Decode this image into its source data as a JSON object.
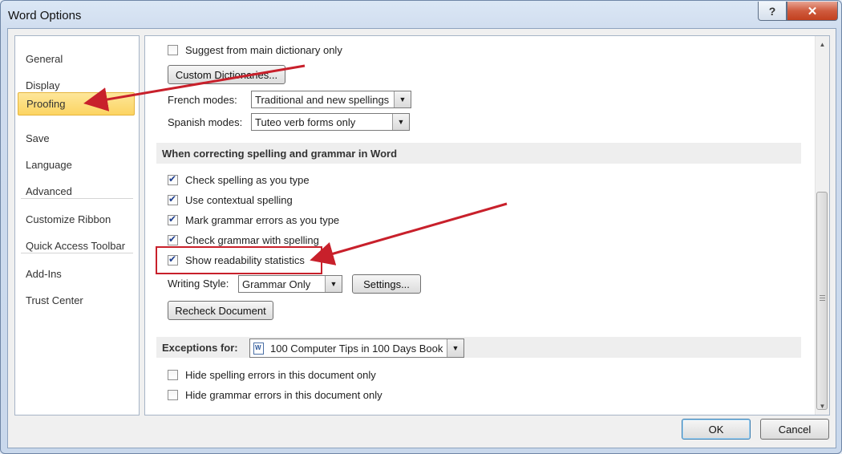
{
  "window": {
    "title": "Word Options",
    "help_label": "?",
    "close_label": "✕"
  },
  "nav": {
    "items": [
      {
        "label": "General"
      },
      {
        "label": "Display"
      },
      {
        "label": "Proofing"
      },
      {
        "label": "Save"
      },
      {
        "label": "Language"
      },
      {
        "label": "Advanced"
      },
      {
        "label": "Customize Ribbon"
      },
      {
        "label": "Quick Access Toolbar"
      },
      {
        "label": "Add-Ins"
      },
      {
        "label": "Trust Center"
      }
    ],
    "selected": "Proofing"
  },
  "content": {
    "suggest_main_dict": {
      "label": "Suggest from main dictionary only",
      "checked": false
    },
    "custom_dictionaries_label": "Custom Dictionaries...",
    "french_modes": {
      "label": "French modes:",
      "value": "Traditional and new spellings"
    },
    "spanish_modes": {
      "label": "Spanish modes:",
      "value": "Tuteo verb forms only"
    },
    "section_word": {
      "title": "When correcting spelling and grammar in Word"
    },
    "checks": [
      {
        "label": "Check spelling as you type",
        "checked": true
      },
      {
        "label": "Use contextual spelling",
        "checked": true
      },
      {
        "label": "Mark grammar errors as you type",
        "checked": true
      },
      {
        "label": "Check grammar with spelling",
        "checked": true
      },
      {
        "label": "Show readability statistics",
        "checked": true
      }
    ],
    "writing_style": {
      "label": "Writing Style:",
      "value": "Grammar Only",
      "settings_label": "Settings..."
    },
    "recheck_label": "Recheck Document",
    "exceptions": {
      "label": "Exceptions for:",
      "value": "100 Computer Tips in 100 Days Book"
    },
    "exception_checks": [
      {
        "label": "Hide spelling errors in this document only",
        "checked": false
      },
      {
        "label": "Hide grammar errors in this document only",
        "checked": false
      }
    ]
  },
  "footer": {
    "ok_label": "OK",
    "cancel_label": "Cancel"
  },
  "colors": {
    "annotation_red": "#c8202b",
    "selected_nav": "#fcd462"
  }
}
